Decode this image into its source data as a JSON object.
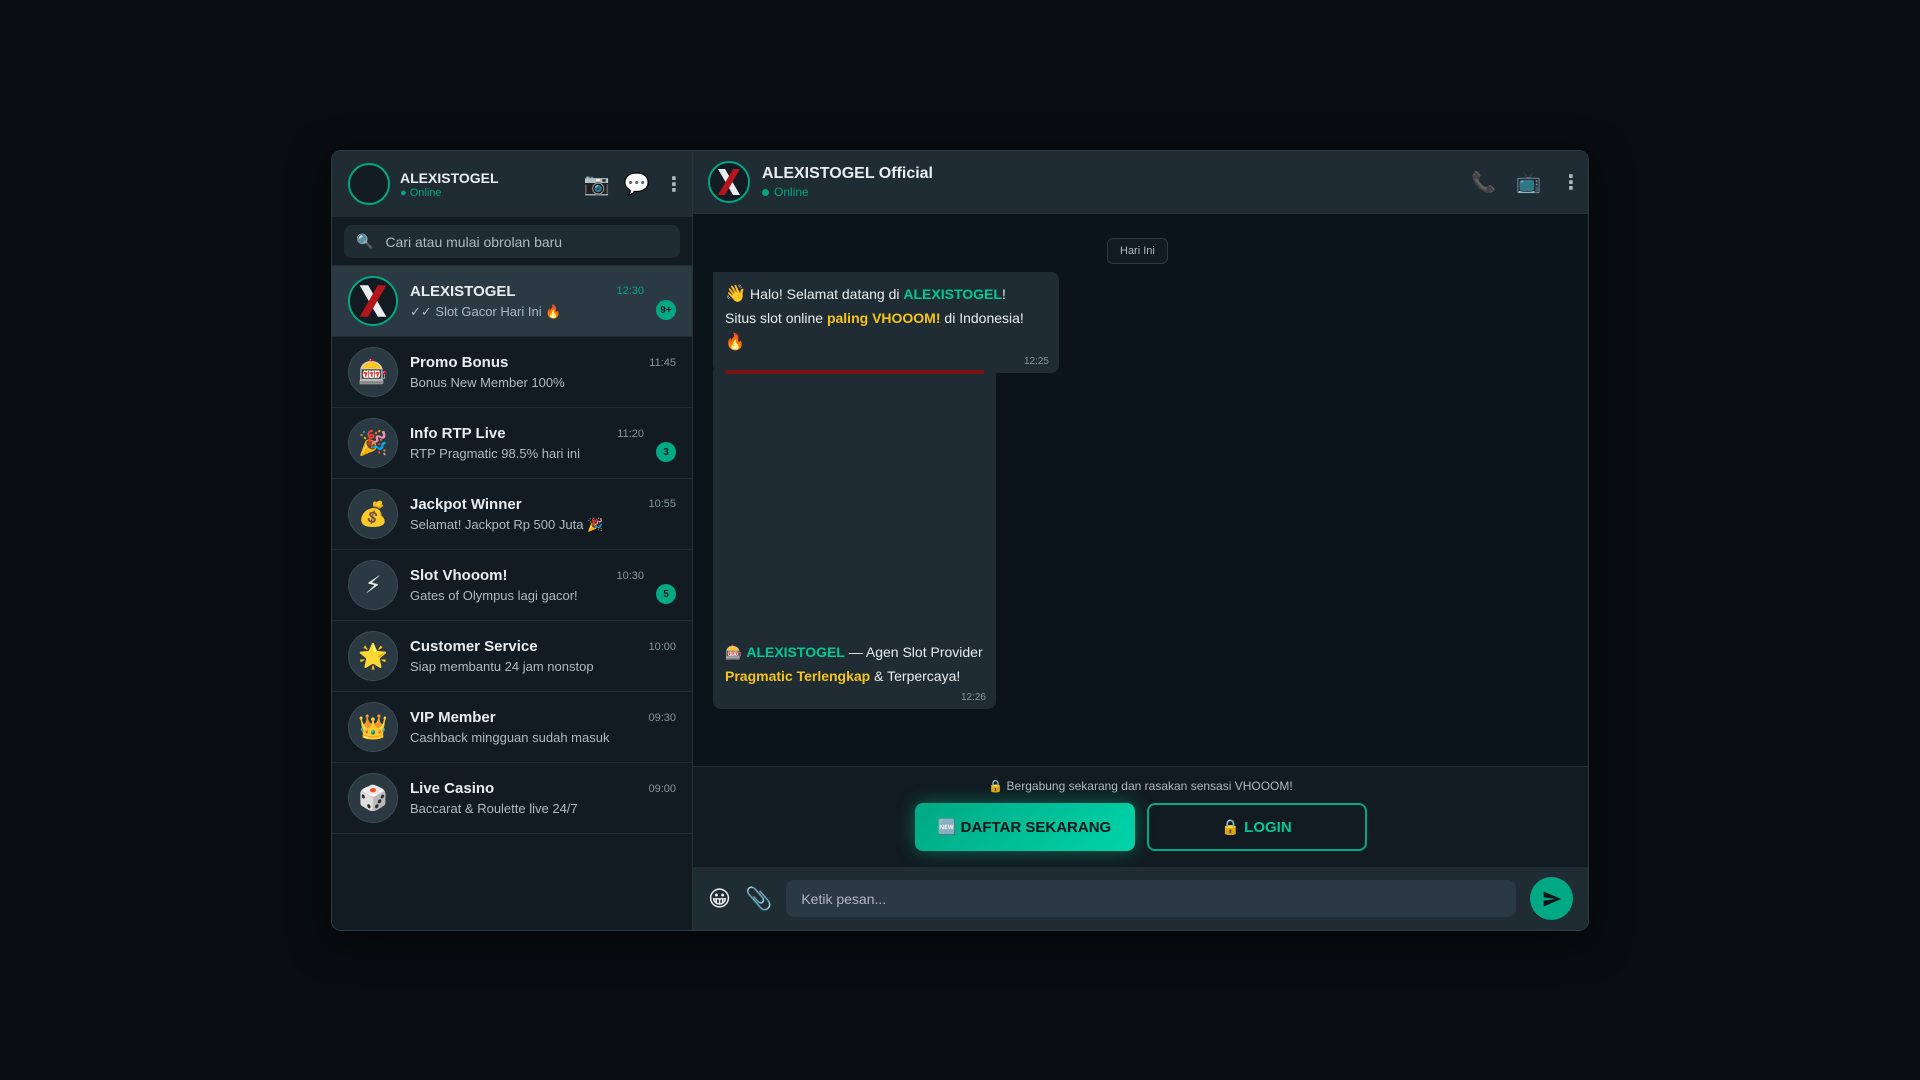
{
  "profile": {
    "name": "ALEXISTOGEL",
    "status": "● Online"
  },
  "header_icons": {
    "camera": "camera-icon",
    "chat": "chat-icon",
    "menu": "menu-icon"
  },
  "search": {
    "placeholder": "Cari atau mulai obrolan baru"
  },
  "chats": [
    {
      "name": "ALEXISTOGEL",
      "time": "12:30",
      "message": "✓✓ Slot Gacor Hari Ini 🔥",
      "badge": "9+",
      "avatar": "logo",
      "active": true
    },
    {
      "name": "Promo Bonus",
      "time": "11:45",
      "message": "Bonus New Member 100%",
      "badge": "",
      "avatar": "🎰"
    },
    {
      "name": "Info RTP Live",
      "time": "11:20",
      "message": "RTP Pragmatic 98.5% hari ini",
      "badge": "3",
      "avatar": "🎉"
    },
    {
      "name": "Jackpot Winner",
      "time": "10:55",
      "message": "Selamat! Jackpot Rp 500 Juta 🎉",
      "badge": "",
      "avatar": "💰"
    },
    {
      "name": "Slot Vhooom!",
      "time": "10:30",
      "message": "Gates of Olympus lagi gacor!",
      "badge": "5",
      "avatar": "⚡"
    },
    {
      "name": "Customer Service",
      "time": "10:00",
      "message": "Siap membantu 24 jam nonstop",
      "badge": "",
      "avatar": "🌟"
    },
    {
      "name": "VIP Member",
      "time": "09:30",
      "message": "Cashback mingguan sudah masuk",
      "badge": "",
      "avatar": "👑"
    },
    {
      "name": "Live Casino",
      "time": "09:00",
      "message": "Baccarat & Roulette live 24/7",
      "badge": "",
      "avatar": "🎲"
    }
  ],
  "conversation": {
    "name": "ALEXISTOGEL Official",
    "status": "Online",
    "date_chip": "Hari Ini",
    "msg1": {
      "wave": "👋",
      "p1": " Halo! Selamat datang di ",
      "brand": "ALEXISTOGEL",
      "p2": "!",
      "p3": "Situs slot online ",
      "gold": "paling VHOOOM!",
      "p4": " di Indonesia! ",
      "fire": "🔥",
      "time": "12:25"
    },
    "msg2": {
      "icon": "🎰",
      "brand": "ALEXISTOGEL",
      "p1": " — Agen Slot Provider",
      "gold": "Pragmatic Terlengkap",
      "p2": " & Terpercaya!",
      "time": "12:26"
    }
  },
  "cta": {
    "note": "🔒 Bergabung sekarang dan rasakan sensasi VHOOOM!",
    "register_label": "🆕 DAFTAR SEKARANG",
    "login_label": "🔒 LOGIN"
  },
  "composer": {
    "placeholder": "Ketik pesan...",
    "emoji": "😀",
    "attach": "📎"
  },
  "colors": {
    "accent": "#00a884",
    "gold": "#f5c518",
    "panel": "#1f2c33"
  }
}
